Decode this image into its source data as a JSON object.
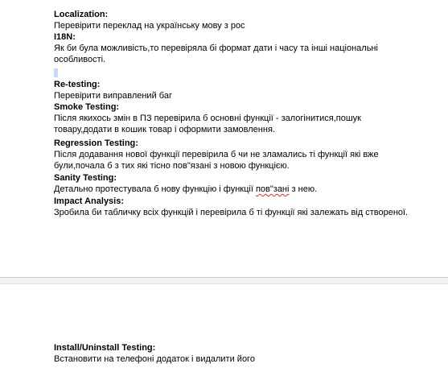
{
  "sections": {
    "localization": {
      "heading": "Localization:",
      "lines": [
        "Перевірити переклад на українську мову з рос"
      ]
    },
    "i18n": {
      "heading": "I18N:",
      "lines": [
        "Як би була можливість,то перевіряла бі формат дати і часу та інші національні",
        "особливості."
      ]
    },
    "retesting": {
      "heading": "Re-testing:",
      "lines": [
        "Перевірити виправлений баг"
      ]
    },
    "smoke": {
      "heading": "Smoke Testing:",
      "lines": [
        "Після якихось змін в ПЗ перевірила б основні функції - залогінитися,пошук",
        "товару,додати в кошик товар і оформити замовлення."
      ]
    },
    "regression": {
      "heading": "Regression Testing:",
      "lines": [
        "Після додавання нової функції перевірила б чи не зламались ті функції які вже",
        "були,почала б з тих які тісно пов\"язані з новою функцією."
      ]
    },
    "sanity": {
      "heading": "Sanity Testing:",
      "line_before": "Детально протестувала б нову функцію і функції ",
      "line_flagged": "пов\"зані",
      "line_after": " з нею."
    },
    "impact": {
      "heading": "Impact Analysis:",
      "lines": [
        "Зробила би табличку всіх функцій і перевірила б ті функції які залежать від створеної."
      ]
    },
    "install": {
      "heading": "Install/Uninstall Testing:",
      "lines": [
        "Встановити на телефоні додаток і видалити його"
      ]
    }
  },
  "colors": {
    "page_gap": "#f1f3f4",
    "selection": "#c8dafb",
    "spellcheck": "#d93025"
  }
}
